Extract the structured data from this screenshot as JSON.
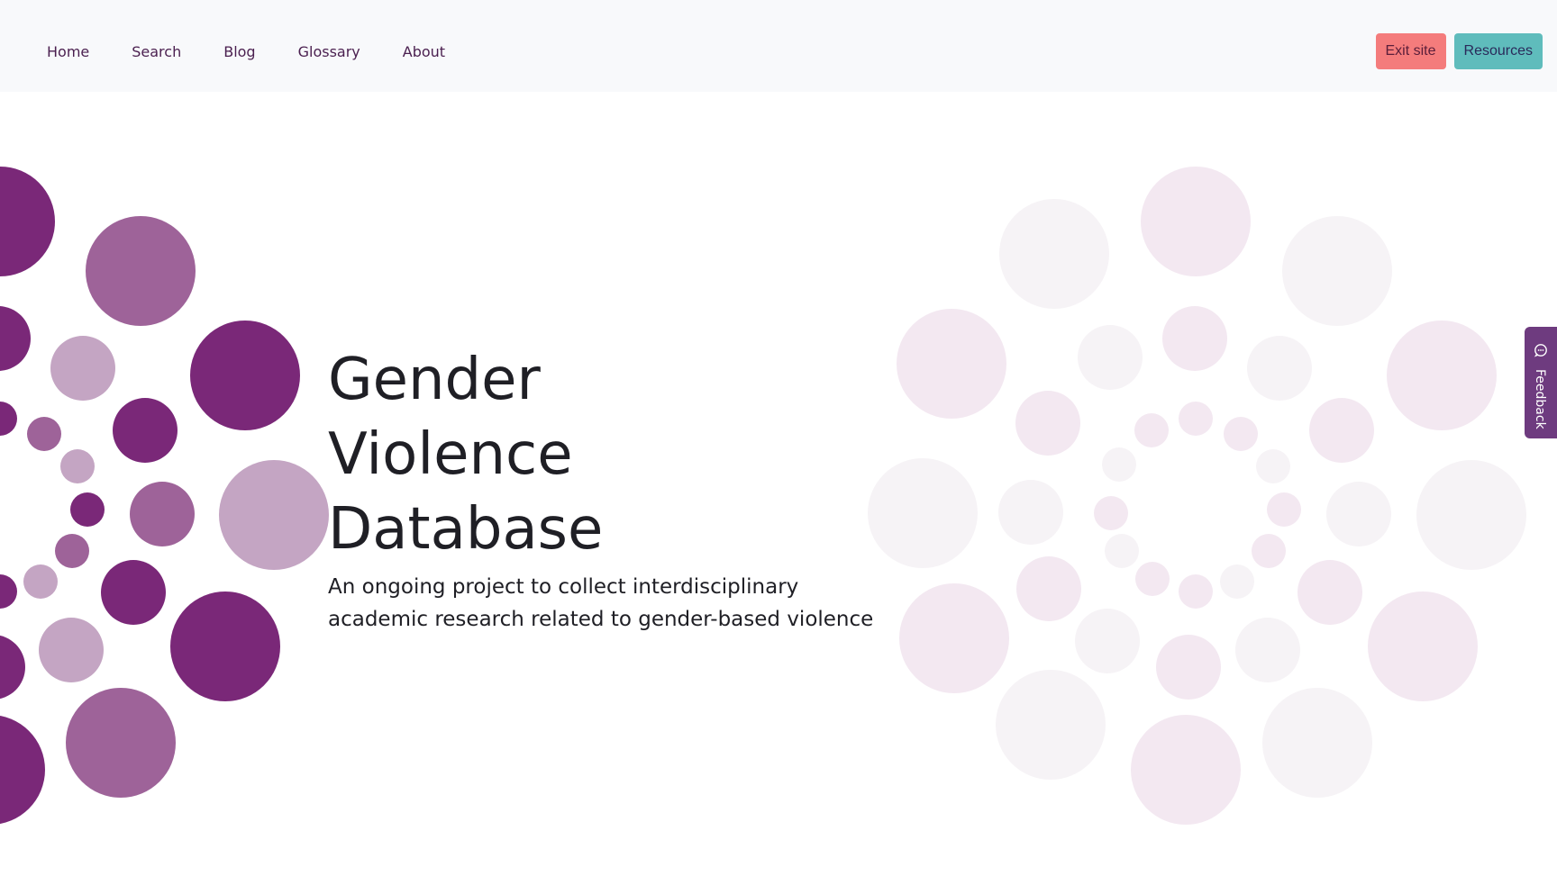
{
  "navbar": {
    "links": [
      {
        "label": "Home"
      },
      {
        "label": "Search"
      },
      {
        "label": "Blog"
      },
      {
        "label": "Glossary"
      },
      {
        "label": "About"
      }
    ],
    "exit_label": "Exit site",
    "resources_label": "Resources"
  },
  "hero": {
    "title": "Gender Violence Database",
    "subtitle": "An ongoing project to collect interdisciplinary academic research related to gender-based violence"
  },
  "feedback": {
    "label": "Feedback",
    "icon": "chat-bubble-icon"
  },
  "colors": {
    "brand_purple": "#7a2878",
    "mid_purple": "#9e6399",
    "light_purple": "#c4a5c3",
    "faint_pink": "#f3e8f1",
    "faint_gray": "#f6f3f6",
    "exit_button": "#f47c7c",
    "resources_button": "#5fbcbc",
    "feedback_tab": "#6e3b7f"
  }
}
